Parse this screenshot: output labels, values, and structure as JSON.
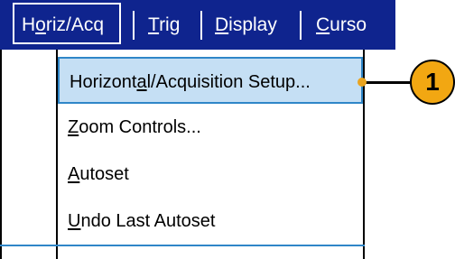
{
  "menubar": {
    "tabs": [
      {
        "label": "Horiz/Acq",
        "underline_index": 1
      },
      {
        "label": "Trig",
        "underline_index": 0
      },
      {
        "label": "Display",
        "underline_index": 0
      },
      {
        "label": "Curso",
        "underline_index": 0
      }
    ]
  },
  "dropdown": {
    "items": [
      {
        "label": "Horizontal/Acquisition Setup...",
        "underline_index": 8
      },
      {
        "label": "Zoom Controls...",
        "underline_index": 0
      },
      {
        "label": "Autoset",
        "underline_index": 0
      },
      {
        "label": "Undo Last Autoset",
        "underline_index": 0
      }
    ]
  },
  "callout": {
    "number": "1"
  },
  "colors": {
    "menubar_bg": "#0f248e",
    "highlight_bg": "#c5dff4",
    "highlight_border": "#2f86c8",
    "callout_fill": "#f2a712"
  }
}
